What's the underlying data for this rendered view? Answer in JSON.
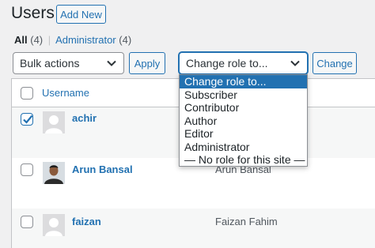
{
  "header": {
    "title": "Users",
    "add_new_label": "Add New"
  },
  "views": {
    "all_label": "All",
    "all_count": "(4)",
    "separator": "|",
    "admin_label": "Administrator",
    "admin_count": "(4)"
  },
  "toolbar": {
    "bulk_actions_value": "Bulk actions",
    "apply_label": "Apply",
    "change_role_value": "Change role to...",
    "change_label": "Change"
  },
  "role_dropdown": {
    "options": [
      "Change role to...",
      "Subscriber",
      "Contributor",
      "Author",
      "Editor",
      "Administrator",
      "— No role for this site —"
    ],
    "selected_index": 0
  },
  "table": {
    "columns": {
      "username": "Username"
    },
    "rows": [
      {
        "username": "achir",
        "name": "",
        "checked": true
      },
      {
        "username": "Arun Bansal",
        "name": "Arun Bansal",
        "checked": false
      },
      {
        "username": "faizan",
        "name": "Faizan Fahim",
        "checked": false
      }
    ]
  },
  "colors": {
    "accent": "#2271b1",
    "background": "#f0f0f1"
  }
}
